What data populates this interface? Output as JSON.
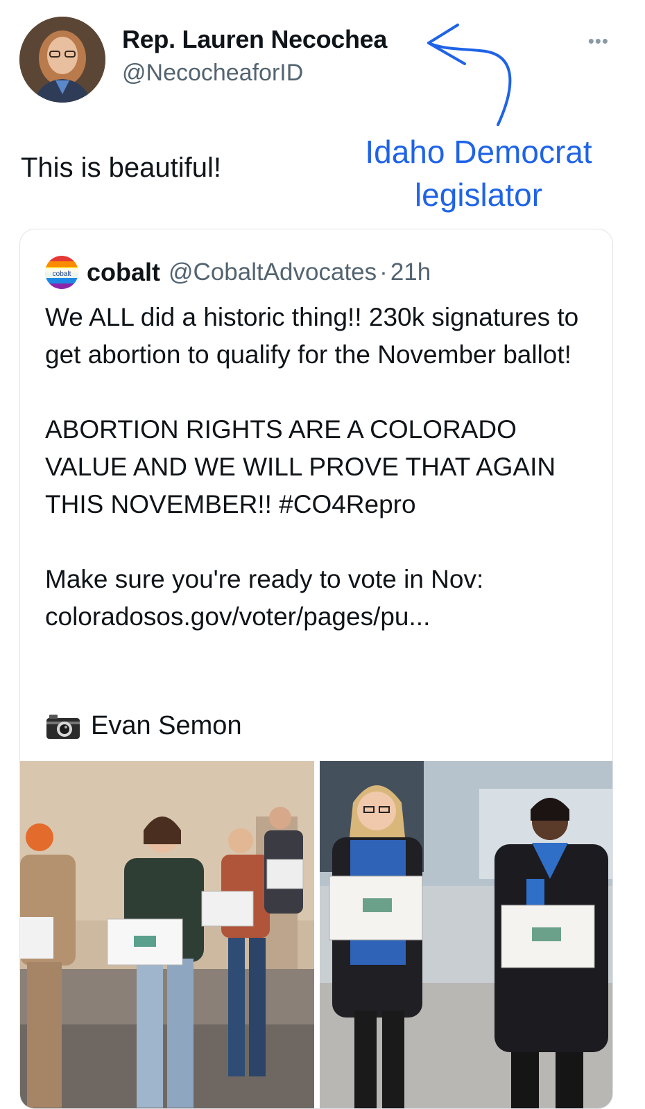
{
  "tweet": {
    "author_name": "Rep. Lauren Necochea",
    "author_handle": "@NecocheaforID",
    "text": "This is beautiful!",
    "more_icon": "more-icon"
  },
  "annotation": {
    "line1": "Idaho Democrat",
    "line2": "legislator",
    "color": "#1f63e6"
  },
  "quoted": {
    "logo_text": "cobalt",
    "name": "cobalt",
    "handle": "@CobaltAdvocates",
    "time": "21h",
    "separator": "·",
    "body": "We ALL did a historic thing!! 230k signatures to get abortion to qualify for the November ballot!\n\nABORTION RIGHTS ARE A COLORADO VALUE AND WE WILL PROVE THAT AGAIN THIS NOVEMBER!! #CO4Repro\n\nMake sure you're ready to vote in Nov: coloradosos.gov/voter/pages/pu...",
    "photo_credit": "Evan Semon",
    "camera_icon": "camera-icon"
  }
}
